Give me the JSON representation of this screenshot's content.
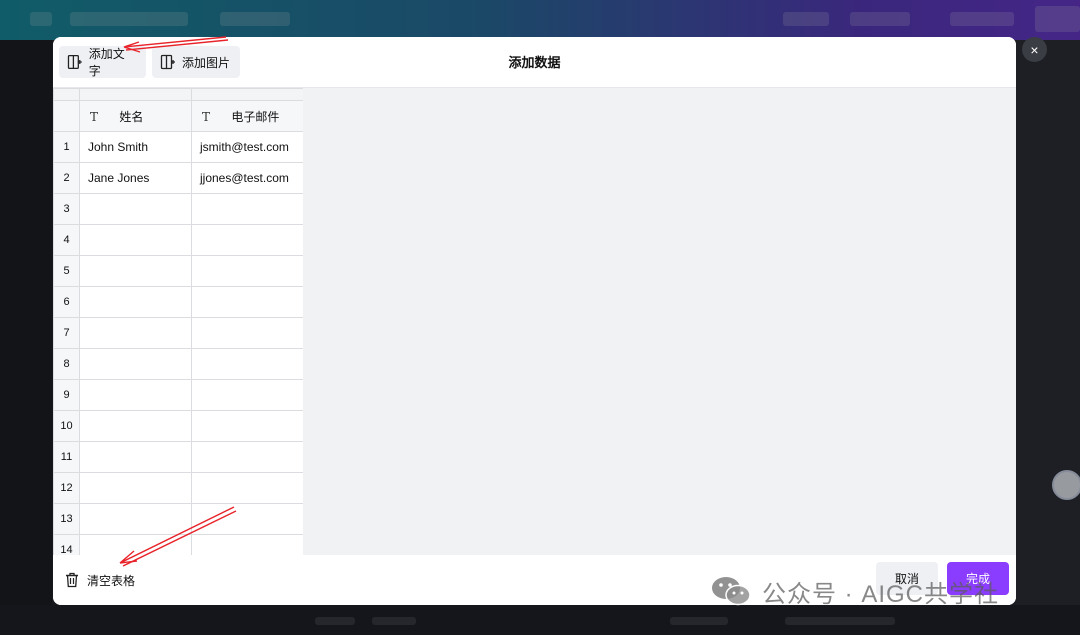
{
  "modal": {
    "title": "添加数据",
    "add_text_label": "添加文字",
    "add_image_label": "添加图片",
    "close_glyph": "×"
  },
  "table": {
    "columns": [
      {
        "type_glyph": "T",
        "label": "姓名"
      },
      {
        "type_glyph": "T",
        "label": "电子邮件"
      }
    ],
    "rows": [
      {
        "num": "1",
        "name": "John Smith",
        "email": "jsmith@test.com"
      },
      {
        "num": "2",
        "name": "Jane Jones",
        "email": "jjones@test.com"
      },
      {
        "num": "3",
        "name": "",
        "email": ""
      },
      {
        "num": "4",
        "name": "",
        "email": ""
      },
      {
        "num": "5",
        "name": "",
        "email": ""
      },
      {
        "num": "6",
        "name": "",
        "email": ""
      },
      {
        "num": "7",
        "name": "",
        "email": ""
      },
      {
        "num": "8",
        "name": "",
        "email": ""
      },
      {
        "num": "9",
        "name": "",
        "email": ""
      },
      {
        "num": "10",
        "name": "",
        "email": ""
      },
      {
        "num": "11",
        "name": "",
        "email": ""
      },
      {
        "num": "12",
        "name": "",
        "email": ""
      },
      {
        "num": "13",
        "name": "",
        "email": ""
      },
      {
        "num": "14",
        "name": "",
        "email": ""
      }
    ]
  },
  "footer": {
    "clear_label": "清空表格",
    "cancel_label": "取消",
    "done_label": "完成"
  },
  "watermark": {
    "text": "公众号 · AIGC共学社"
  },
  "colors": {
    "accent": "#8b3dff",
    "annotation_arrow": "#e8232a"
  },
  "icons": {
    "add_text": "add-column-icon",
    "add_image": "add-column-icon",
    "clear": "trash-icon",
    "close": "close-icon",
    "watermark": "wechat-icon"
  }
}
